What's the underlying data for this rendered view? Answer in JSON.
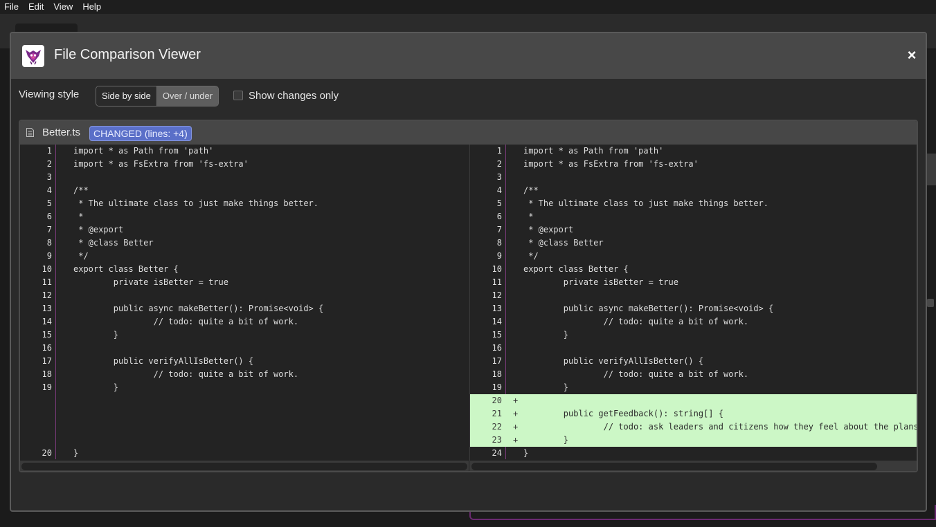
{
  "menu": [
    "File",
    "Edit",
    "View",
    "Help"
  ],
  "dialog": {
    "title": "File Comparison Viewer",
    "close_symbol": "×"
  },
  "controls": {
    "viewing_style_label": "Viewing style",
    "options": [
      "Side by side",
      "Over / under"
    ],
    "selected_option": "Side by side",
    "show_changes_label": "Show changes only",
    "show_changes_checked": false
  },
  "file": {
    "name": "Better.ts",
    "badge": "CHANGED (lines: +4)"
  },
  "colors": {
    "added_line_bg": "#ccf7c6",
    "badge_bg": "#5a6fc8",
    "gutter_border": "#7a3a7a"
  },
  "left_lines": [
    {
      "num": "1",
      "code": "import * as Path from 'path'"
    },
    {
      "num": "2",
      "code": "import * as FsExtra from 'fs-extra'"
    },
    {
      "num": "3",
      "code": ""
    },
    {
      "num": "4",
      "code": "/**"
    },
    {
      "num": "5",
      "code": " * The ultimate class to just make things better."
    },
    {
      "num": "6",
      "code": " *"
    },
    {
      "num": "7",
      "code": " * @export"
    },
    {
      "num": "8",
      "code": " * @class Better"
    },
    {
      "num": "9",
      "code": " */"
    },
    {
      "num": "10",
      "code": "export class Better {"
    },
    {
      "num": "11",
      "code": "        private isBetter = true"
    },
    {
      "num": "12",
      "code": ""
    },
    {
      "num": "13",
      "code": "        public async makeBetter(): Promise<void> {"
    },
    {
      "num": "14",
      "code": "                // todo: quite a bit of work."
    },
    {
      "num": "15",
      "code": "        }"
    },
    {
      "num": "16",
      "code": ""
    },
    {
      "num": "17",
      "code": "        public verifyAllIsBetter() {"
    },
    {
      "num": "18",
      "code": "                // todo: quite a bit of work."
    },
    {
      "num": "19",
      "code": "        }"
    },
    {
      "num": "",
      "code": "",
      "spacer": true
    },
    {
      "num": "",
      "code": "",
      "spacer": true
    },
    {
      "num": "",
      "code": "",
      "spacer": true
    },
    {
      "num": "",
      "code": "",
      "spacer": true
    },
    {
      "num": "20",
      "code": "}"
    }
  ],
  "right_lines": [
    {
      "num": "1",
      "code": "import * as Path from 'path'"
    },
    {
      "num": "2",
      "code": "import * as FsExtra from 'fs-extra'"
    },
    {
      "num": "3",
      "code": ""
    },
    {
      "num": "4",
      "code": "/**"
    },
    {
      "num": "5",
      "code": " * The ultimate class to just make things better."
    },
    {
      "num": "6",
      "code": " *"
    },
    {
      "num": "7",
      "code": " * @export"
    },
    {
      "num": "8",
      "code": " * @class Better"
    },
    {
      "num": "9",
      "code": " */"
    },
    {
      "num": "10",
      "code": "export class Better {"
    },
    {
      "num": "11",
      "code": "        private isBetter = true"
    },
    {
      "num": "12",
      "code": ""
    },
    {
      "num": "13",
      "code": "        public async makeBetter(): Promise<void> {"
    },
    {
      "num": "14",
      "code": "                // todo: quite a bit of work."
    },
    {
      "num": "15",
      "code": "        }"
    },
    {
      "num": "16",
      "code": ""
    },
    {
      "num": "17",
      "code": "        public verifyAllIsBetter() {"
    },
    {
      "num": "18",
      "code": "                // todo: quite a bit of work."
    },
    {
      "num": "19",
      "code": "        }"
    },
    {
      "num": "20",
      "code": "",
      "added": true,
      "marker": "+"
    },
    {
      "num": "21",
      "code": "        public getFeedback(): string[] {",
      "added": true,
      "marker": "+"
    },
    {
      "num": "22",
      "code": "                // todo: ask leaders and citizens how they feel about the plans.",
      "added": true,
      "marker": "+"
    },
    {
      "num": "23",
      "code": "        }",
      "added": true,
      "marker": "+"
    },
    {
      "num": "24",
      "code": "}"
    }
  ]
}
